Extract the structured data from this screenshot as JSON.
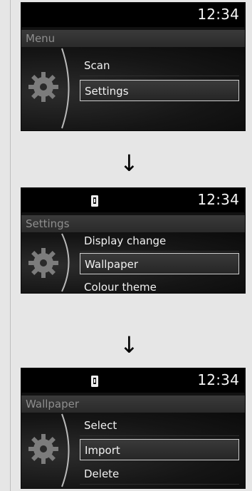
{
  "screens": [
    {
      "clock": "12:34",
      "show_usb": false,
      "title": "Menu",
      "items": [
        "Scan",
        "Settings"
      ],
      "selected_index": 1
    },
    {
      "clock": "12:34",
      "show_usb": true,
      "title": "Settings",
      "items": [
        "Display change",
        "Wallpaper",
        "Colour theme"
      ],
      "selected_index": 1
    },
    {
      "clock": "12:34",
      "show_usb": true,
      "title": "Wallpaper",
      "items": [
        "Select",
        "Import",
        "Delete"
      ],
      "selected_index": 1
    }
  ],
  "arrow_glyph": "↓",
  "icons": {
    "settings": "gear-icon",
    "usb": "usb-icon"
  }
}
